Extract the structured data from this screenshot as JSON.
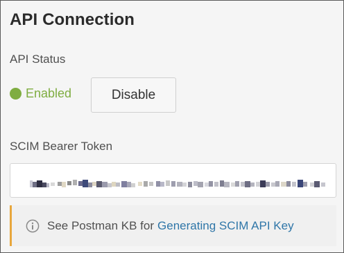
{
  "panel": {
    "title": "API Connection"
  },
  "api_status": {
    "label": "API Status",
    "value": "Enabled",
    "color": "#7fad41",
    "button_label": "Disable"
  },
  "token": {
    "label": "SCIM Bearer Token",
    "value_obscured": true
  },
  "info": {
    "icon": "info-circle-icon",
    "text": "See Postman KB for",
    "link_text": "Generating SCIM API Key",
    "link_color": "#2f76a8",
    "accent_color": "#e8a73c"
  }
}
